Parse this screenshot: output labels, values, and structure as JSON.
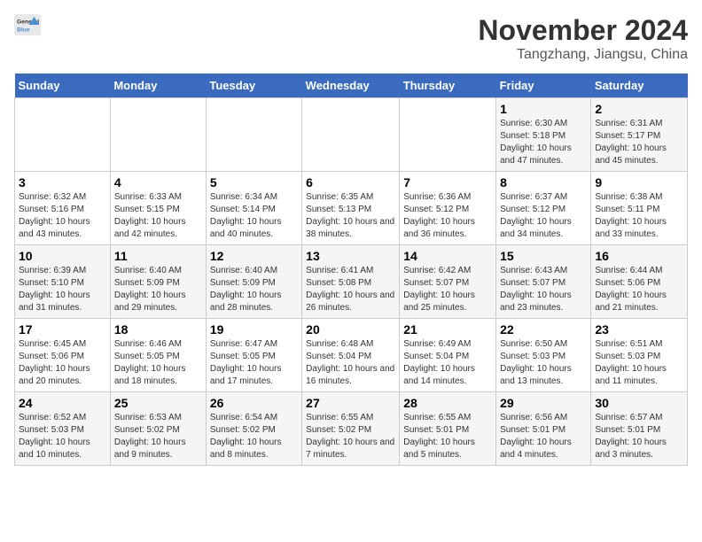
{
  "header": {
    "logo_general": "General",
    "logo_blue": "Blue",
    "title": "November 2024",
    "subtitle": "Tangzhang, Jiangsu, China"
  },
  "days_of_week": [
    "Sunday",
    "Monday",
    "Tuesday",
    "Wednesday",
    "Thursday",
    "Friday",
    "Saturday"
  ],
  "weeks": [
    [
      {
        "day": "",
        "info": ""
      },
      {
        "day": "",
        "info": ""
      },
      {
        "day": "",
        "info": ""
      },
      {
        "day": "",
        "info": ""
      },
      {
        "day": "",
        "info": ""
      },
      {
        "day": "1",
        "info": "Sunrise: 6:30 AM\nSunset: 5:18 PM\nDaylight: 10 hours and 47 minutes."
      },
      {
        "day": "2",
        "info": "Sunrise: 6:31 AM\nSunset: 5:17 PM\nDaylight: 10 hours and 45 minutes."
      }
    ],
    [
      {
        "day": "3",
        "info": "Sunrise: 6:32 AM\nSunset: 5:16 PM\nDaylight: 10 hours and 43 minutes."
      },
      {
        "day": "4",
        "info": "Sunrise: 6:33 AM\nSunset: 5:15 PM\nDaylight: 10 hours and 42 minutes."
      },
      {
        "day": "5",
        "info": "Sunrise: 6:34 AM\nSunset: 5:14 PM\nDaylight: 10 hours and 40 minutes."
      },
      {
        "day": "6",
        "info": "Sunrise: 6:35 AM\nSunset: 5:13 PM\nDaylight: 10 hours and 38 minutes."
      },
      {
        "day": "7",
        "info": "Sunrise: 6:36 AM\nSunset: 5:12 PM\nDaylight: 10 hours and 36 minutes."
      },
      {
        "day": "8",
        "info": "Sunrise: 6:37 AM\nSunset: 5:12 PM\nDaylight: 10 hours and 34 minutes."
      },
      {
        "day": "9",
        "info": "Sunrise: 6:38 AM\nSunset: 5:11 PM\nDaylight: 10 hours and 33 minutes."
      }
    ],
    [
      {
        "day": "10",
        "info": "Sunrise: 6:39 AM\nSunset: 5:10 PM\nDaylight: 10 hours and 31 minutes."
      },
      {
        "day": "11",
        "info": "Sunrise: 6:40 AM\nSunset: 5:09 PM\nDaylight: 10 hours and 29 minutes."
      },
      {
        "day": "12",
        "info": "Sunrise: 6:40 AM\nSunset: 5:09 PM\nDaylight: 10 hours and 28 minutes."
      },
      {
        "day": "13",
        "info": "Sunrise: 6:41 AM\nSunset: 5:08 PM\nDaylight: 10 hours and 26 minutes."
      },
      {
        "day": "14",
        "info": "Sunrise: 6:42 AM\nSunset: 5:07 PM\nDaylight: 10 hours and 25 minutes."
      },
      {
        "day": "15",
        "info": "Sunrise: 6:43 AM\nSunset: 5:07 PM\nDaylight: 10 hours and 23 minutes."
      },
      {
        "day": "16",
        "info": "Sunrise: 6:44 AM\nSunset: 5:06 PM\nDaylight: 10 hours and 21 minutes."
      }
    ],
    [
      {
        "day": "17",
        "info": "Sunrise: 6:45 AM\nSunset: 5:06 PM\nDaylight: 10 hours and 20 minutes."
      },
      {
        "day": "18",
        "info": "Sunrise: 6:46 AM\nSunset: 5:05 PM\nDaylight: 10 hours and 18 minutes."
      },
      {
        "day": "19",
        "info": "Sunrise: 6:47 AM\nSunset: 5:05 PM\nDaylight: 10 hours and 17 minutes."
      },
      {
        "day": "20",
        "info": "Sunrise: 6:48 AM\nSunset: 5:04 PM\nDaylight: 10 hours and 16 minutes."
      },
      {
        "day": "21",
        "info": "Sunrise: 6:49 AM\nSunset: 5:04 PM\nDaylight: 10 hours and 14 minutes."
      },
      {
        "day": "22",
        "info": "Sunrise: 6:50 AM\nSunset: 5:03 PM\nDaylight: 10 hours and 13 minutes."
      },
      {
        "day": "23",
        "info": "Sunrise: 6:51 AM\nSunset: 5:03 PM\nDaylight: 10 hours and 11 minutes."
      }
    ],
    [
      {
        "day": "24",
        "info": "Sunrise: 6:52 AM\nSunset: 5:03 PM\nDaylight: 10 hours and 10 minutes."
      },
      {
        "day": "25",
        "info": "Sunrise: 6:53 AM\nSunset: 5:02 PM\nDaylight: 10 hours and 9 minutes."
      },
      {
        "day": "26",
        "info": "Sunrise: 6:54 AM\nSunset: 5:02 PM\nDaylight: 10 hours and 8 minutes."
      },
      {
        "day": "27",
        "info": "Sunrise: 6:55 AM\nSunset: 5:02 PM\nDaylight: 10 hours and 7 minutes."
      },
      {
        "day": "28",
        "info": "Sunrise: 6:55 AM\nSunset: 5:01 PM\nDaylight: 10 hours and 5 minutes."
      },
      {
        "day": "29",
        "info": "Sunrise: 6:56 AM\nSunset: 5:01 PM\nDaylight: 10 hours and 4 minutes."
      },
      {
        "day": "30",
        "info": "Sunrise: 6:57 AM\nSunset: 5:01 PM\nDaylight: 10 hours and 3 minutes."
      }
    ]
  ]
}
